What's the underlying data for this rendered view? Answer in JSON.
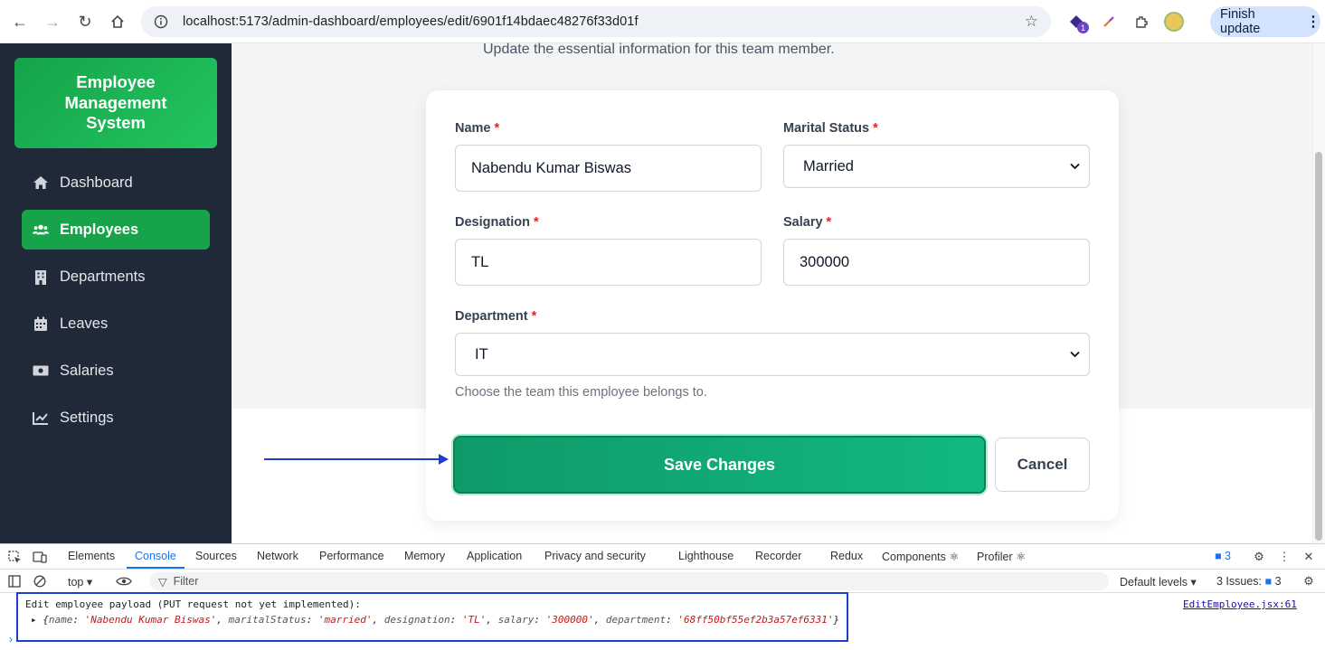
{
  "browser": {
    "url": "localhost:5173/admin-dashboard/employees/edit/6901f14bdaec48276f33d01f",
    "finish_update_label": "Finish update",
    "extension_badge": "1"
  },
  "sidebar": {
    "brand": "Employee Management System",
    "items": [
      {
        "label": "Dashboard",
        "icon": "home-icon"
      },
      {
        "label": "Employees",
        "icon": "users-icon",
        "active": true
      },
      {
        "label": "Departments",
        "icon": "building-icon"
      },
      {
        "label": "Leaves",
        "icon": "calendar-icon"
      },
      {
        "label": "Salaries",
        "icon": "money-icon"
      },
      {
        "label": "Settings",
        "icon": "chart-line-icon"
      }
    ],
    "active_color": "#16a34a"
  },
  "page": {
    "subtitle": "Update the essential information for this team member."
  },
  "form": {
    "name_label": "Name",
    "name_value": "Nabendu Kumar Biswas",
    "marital_label": "Marital Status",
    "marital_value": "Married",
    "designation_label": "Designation",
    "designation_value": "TL",
    "salary_label": "Salary",
    "salary_value": "300000",
    "department_label": "Department",
    "department_value": "IT",
    "department_helper": "Choose the team this employee belongs to.",
    "required_mark": "*",
    "save_label": "Save Changes",
    "cancel_label": "Cancel"
  },
  "devtools": {
    "tabs": [
      "Elements",
      "Console",
      "Sources",
      "Network",
      "Performance",
      "Memory",
      "Application",
      "Privacy and security",
      "Lighthouse",
      "Recorder",
      "Redux",
      "Components ⚛",
      "Profiler ⚛"
    ],
    "active_tab": "Console",
    "messages_count": "3",
    "context": "top",
    "filter_placeholder": "Filter",
    "levels": "Default levels",
    "issues_label": "3 Issues:",
    "issues_count": "3",
    "log_message": "Edit employee payload (PUT request not yet implemented):",
    "log_source": "EditEmployee.jsx:61",
    "log_object": {
      "name": "'Nabendu Kumar Biswas'",
      "maritalStatus": "'married'",
      "designation": "'TL'",
      "salary": "'300000'",
      "department": "'68ff50bf55ef2b3a57ef6331'"
    }
  }
}
